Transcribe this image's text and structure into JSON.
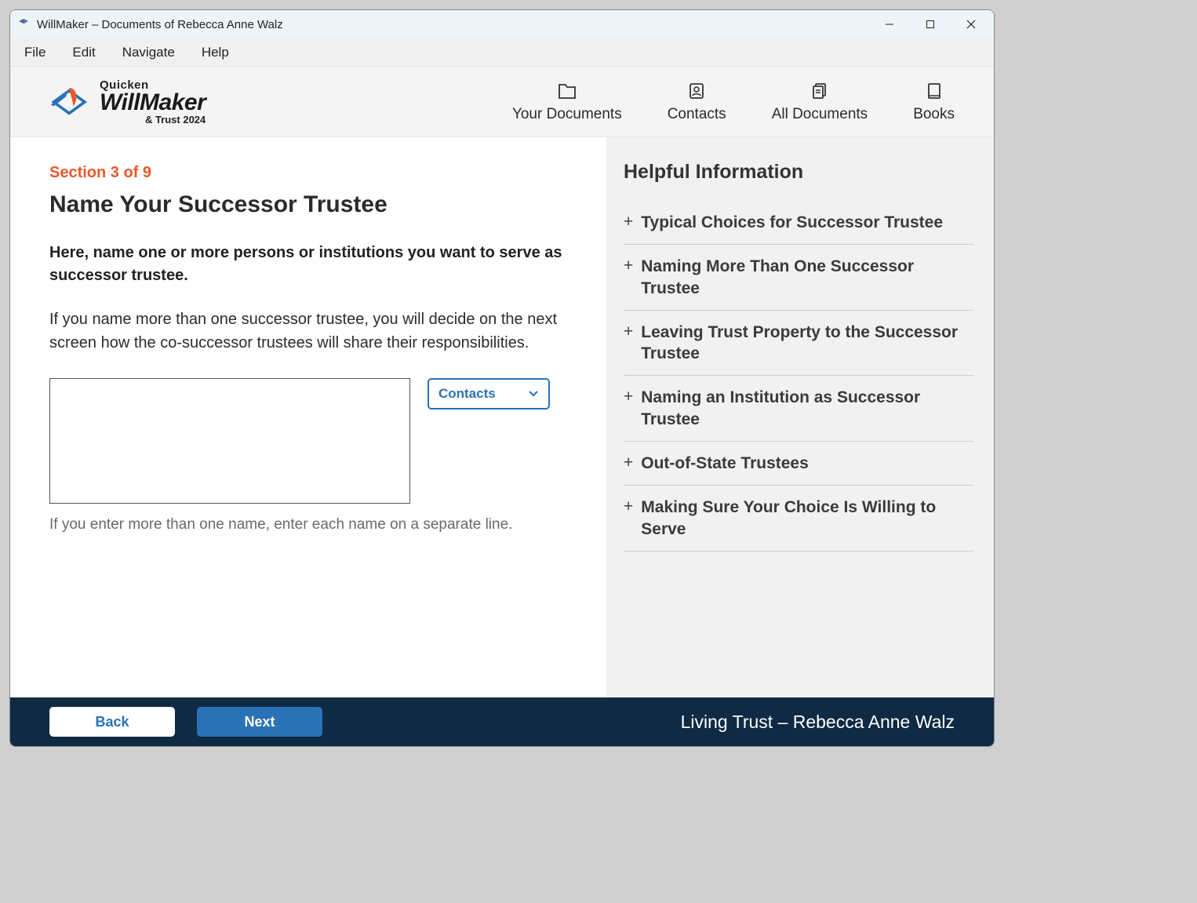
{
  "titlebar": {
    "title": "WillMaker – Documents of Rebecca Anne Walz"
  },
  "menubar": {
    "items": [
      "File",
      "Edit",
      "Navigate",
      "Help"
    ]
  },
  "navbar": {
    "logo": {
      "brand_top": "Quicken",
      "brand_main": "WillMaker",
      "brand_tag": "& Trust 2024"
    },
    "actions": [
      {
        "label": "Your Documents"
      },
      {
        "label": "Contacts"
      },
      {
        "label": "All Documents"
      },
      {
        "label": "Books"
      }
    ]
  },
  "main": {
    "section_label": "Section 3 of 9",
    "page_title": "Name Your Successor Trustee",
    "lead": "Here, name one or more persons or institutions you want to serve as successor trustee.",
    "description": "If you name more than one successor trustee, you will decide on the next screen how the co-successor trustees will share their responsibilities.",
    "textarea_value": "",
    "contacts_dropdown_label": "Contacts",
    "input_help": "If you enter more than one name, enter each name on a separate line."
  },
  "sidebar": {
    "title": "Helpful Information",
    "items": [
      "Typical Choices for Successor Trustee",
      "Naming More Than One Successor Trustee",
      "Leaving Trust Property to the Successor Trustee",
      "Naming an Institution as Successor Trustee",
      "Out-of-State Trustees",
      "Making Sure Your Choice Is Willing to Serve"
    ]
  },
  "footer": {
    "back_label": "Back",
    "next_label": "Next",
    "doc_name": "Living Trust – Rebecca Anne Walz"
  }
}
